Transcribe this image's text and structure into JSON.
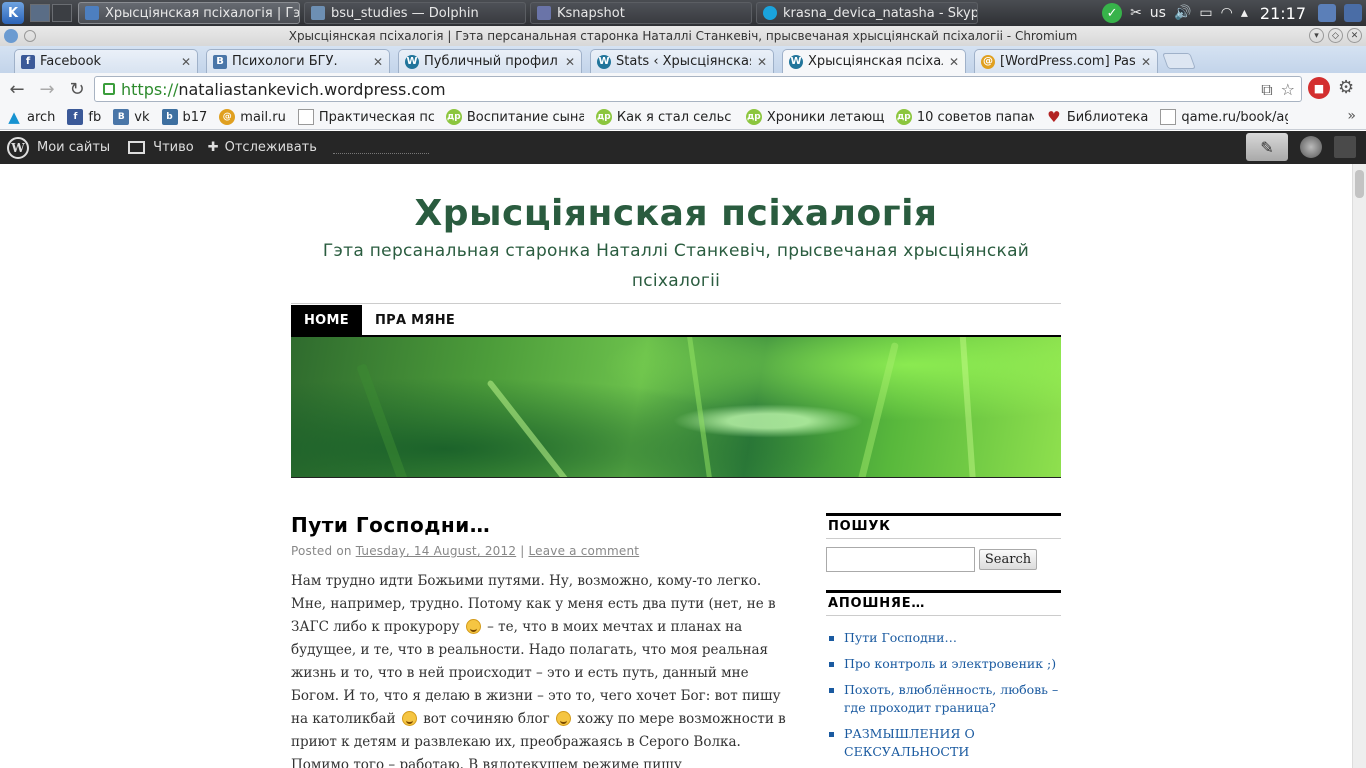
{
  "taskbar": {
    "tasks": [
      {
        "label": "Хрысціянская псіхалогія | Гэта",
        "color": "#4d7fc0",
        "active": true
      },
      {
        "label": "bsu_studies — Dolphin",
        "color": "#6d8fb3",
        "active": false
      },
      {
        "label": "Ksnapshot",
        "color": "#6a74a8",
        "active": false
      },
      {
        "label": "krasna_devica_natasha - Skype",
        "color": "#1aa3dc",
        "active": false
      }
    ],
    "keyboard_layout": "us",
    "clock": "21:17"
  },
  "window": {
    "title": "Хрысціянская псіхалогія | Гэта персанальная старонка Наталлі Станкевіч, прысвечаная хрысціянскай псіхалогіі - Chromium"
  },
  "tabs": [
    {
      "label": "Facebook",
      "icon": "f",
      "color": "#3b5998",
      "active": false
    },
    {
      "label": "Психологи БГУ.",
      "icon": "B",
      "color": "#4a76a8",
      "active": false
    },
    {
      "label": "Публичный профиль",
      "icon": "W",
      "color": "#21759b",
      "active": false
    },
    {
      "label": "Stats ‹ Хрысціянская",
      "icon": "W",
      "color": "#21759b",
      "active": false
    },
    {
      "label": "Хрысціянская псіхал",
      "icon": "W",
      "color": "#21759b",
      "active": true
    },
    {
      "label": "[WordPress.com] Pas",
      "icon": "@",
      "color": "#e0a020",
      "active": false
    }
  ],
  "omnibox": {
    "scheme": "https://",
    "host": "nataliastankevich.wordpress.com"
  },
  "bookmarks": [
    {
      "label": "arch",
      "icon": "arch-icon",
      "color": "#1793d1"
    },
    {
      "label": "fb",
      "icon": "facebook-icon",
      "color": "#3b5998"
    },
    {
      "label": "vk",
      "icon": "vk-icon",
      "color": "#4a76a8"
    },
    {
      "label": "b17",
      "icon": "b17-icon",
      "color": "#3d6fa0"
    },
    {
      "label": "mail.ru",
      "icon": "mailru-icon",
      "color": "#e0a020"
    },
    {
      "label": "Практическая пс",
      "icon": "page-icon",
      "color": "#cccccc"
    },
    {
      "label": "Воспитание сына",
      "icon": "dr-icon",
      "color": "#8cc63f"
    },
    {
      "label": "Как я стал сельс",
      "icon": "dr-icon",
      "color": "#8cc63f"
    },
    {
      "label": "Хроники летающ",
      "icon": "dr-icon",
      "color": "#8cc63f"
    },
    {
      "label": "10 советов папам",
      "icon": "dr-icon",
      "color": "#8cc63f"
    },
    {
      "label": "Библиотека",
      "icon": "heart-icon",
      "color": "#b22222"
    },
    {
      "label": "qame.ru/book/age",
      "icon": "page-icon",
      "color": "#cccccc"
    }
  ],
  "wpbar": {
    "my_sites": "Мои сайты",
    "reader": "Чтиво",
    "follow": "Отслеживать"
  },
  "site": {
    "title": "Хрысціянская псіхалогія",
    "description": "Гэта персанальная старонка Наталлі Станкевіч, прысвечаная хрысціянскай псіхалогіі",
    "menu": [
      "HOME",
      "ПРА МЯНЕ"
    ]
  },
  "post": {
    "title": "Пути Господни…",
    "meta_prefix": "Posted on",
    "date": "Tuesday, 14 August, 2012",
    "separator": "|",
    "comment_link": "Leave a comment",
    "body": [
      {
        "t": "text",
        "v": "Нам трудно идти Божьими путями. Ну, возможно, кому-то легко. Мне, например, трудно. Потому как у меня есть два пути (нет, не в ЗАГС либо к прокурору "
      },
      {
        "t": "smile"
      },
      {
        "t": "text",
        "v": " – те, что в моих мечтах и планах на будущее, и те, что в реальности. Надо полагать, что моя реальная жизнь и то, что в ней происходит  – это и есть путь, данный мне Богом. И то, что я делаю в жизни – это то, чего хочет Бог: вот пишу на католикбай "
      },
      {
        "t": "smile"
      },
      {
        "t": "text",
        "v": " вот сочиняю блог "
      },
      {
        "t": "smile"
      },
      {
        "t": "text",
        "v": " хожу по мере возможности в приют к детям и развлекаю их, преображаясь в Серого Волка. Помимо того – работаю. В вялотекущем режиме пишу"
      }
    ]
  },
  "sidebar": {
    "search_heading": "ПОШУК",
    "search_button": "Search",
    "recent_heading": "АПОШНЯЕ…",
    "recent": [
      "Пути Господни…",
      "Про контроль и электровеник ;)",
      "Похоть, влюблённость, любовь – где проходит граница?",
      "РАЗМЫШЛЕНИЯ О СЕКСУАЛЬНОСТИ"
    ]
  }
}
